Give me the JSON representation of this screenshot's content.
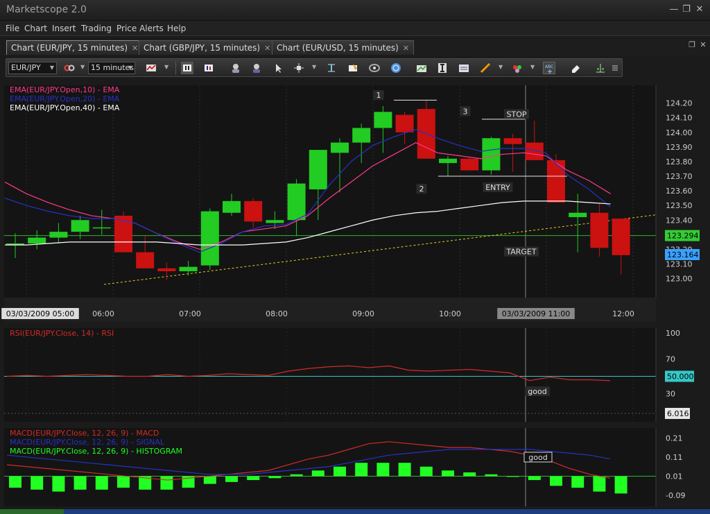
{
  "app": {
    "title": "Marketscope 2.0",
    "window_controls": [
      "minimize-icon",
      "restore-icon",
      "close-icon"
    ]
  },
  "menu": [
    "File",
    "Chart",
    "Insert",
    "Trading",
    "Price Alerts",
    "Help"
  ],
  "tabs": [
    {
      "label": "Chart (EUR/JPY, 15 minutes)",
      "active": true
    },
    {
      "label": "Chart (GBP/JPY, 15 minutes)",
      "active": false
    },
    {
      "label": "Chart (EUR/USD, 15 minutes)",
      "active": false
    }
  ],
  "toolbar": {
    "instrument": "EUR/JPY",
    "timeframe": "15 minutes",
    "icons": [
      "link-icon",
      "chart-type-icon",
      "bar-chart-icon",
      "candle-chart-icon",
      "zoom-in-icon",
      "zoom-out-icon",
      "cursor-icon",
      "crosshair-icon",
      "fibonacci-icon",
      "marker-icon",
      "target-icon",
      "globe-icon",
      "trend-line-icon",
      "text-icon",
      "chart-settings-icon",
      "pen-icon",
      "palette-icon",
      "label-icon",
      "eraser-icon",
      "layout-icon",
      "more-icon"
    ]
  },
  "main_chart": {
    "legend": [
      {
        "text": "EMA(EUR/JPY.Open,10) - EMA",
        "color": "#ff3a8a"
      },
      {
        "text": "EMA(EUR/JPY.Open,20) - EMA",
        "color": "#2632c8"
      },
      {
        "text": "EMA(EUR/JPY.Open,40) - EMA",
        "color": "#ffffff"
      }
    ],
    "y_ticks": [
      "124.20",
      "124.10",
      "124.00",
      "123.90",
      "123.80",
      "123.70",
      "123.60",
      "123.50",
      "123.40",
      "123.30",
      "123.20",
      "123.10",
      "123.00"
    ],
    "y_range": [
      122.96,
      124.26
    ],
    "price_labels": [
      {
        "text": "123.294",
        "value": 123.294,
        "bg": "#33cc33",
        "fg": "#000000"
      },
      {
        "text": "123.164",
        "value": 123.164,
        "bg": "#3aa0ff",
        "fg": "#000000"
      }
    ],
    "x_labels": [
      "03/03/2009 05:00",
      "06:00",
      "07:00",
      "08:00",
      "09:00",
      "10:00",
      "03/03/2009 11:00",
      "12:00"
    ],
    "annotations": [
      "1",
      "2",
      "3",
      "STOP",
      "ENTRY",
      "TARGET"
    ],
    "bull_color": "#22cc22",
    "bear_color": "#cc1111"
  },
  "chart_data": [
    {
      "type": "candlestick",
      "title": "EUR/JPY",
      "ylim": [
        122.96,
        124.26
      ],
      "x": [
        "04:45",
        "05:00",
        "05:15",
        "05:30",
        "05:45",
        "06:00",
        "06:15",
        "06:30",
        "06:45",
        "07:00",
        "07:15",
        "07:30",
        "07:45",
        "08:00",
        "08:15",
        "08:30",
        "08:45",
        "09:00",
        "09:15",
        "09:30",
        "09:45",
        "10:00",
        "10:15",
        "10:30",
        "10:45",
        "11:00",
        "11:15",
        "11:30",
        "11:45"
      ],
      "open": [
        123.24,
        123.24,
        123.28,
        123.32,
        123.35,
        123.43,
        123.18,
        123.07,
        123.05,
        123.09,
        123.45,
        123.53,
        123.38,
        123.4,
        123.61,
        123.86,
        123.93,
        124.03,
        124.12,
        124.16,
        123.79,
        123.82,
        123.74,
        123.96,
        123.93,
        123.81,
        123.42,
        123.45,
        123.41
      ],
      "high": [
        123.31,
        123.33,
        123.38,
        123.43,
        123.47,
        123.46,
        123.29,
        123.11,
        123.12,
        123.48,
        123.58,
        123.55,
        123.46,
        123.68,
        123.74,
        123.96,
        124.06,
        124.18,
        124.14,
        124.22,
        123.84,
        123.83,
        123.97,
        123.99,
        124.08,
        123.85,
        123.58,
        123.52,
        123.24
      ],
      "low": [
        123.14,
        123.2,
        123.24,
        123.27,
        123.3,
        123.36,
        123.07,
        122.99,
        123.02,
        123.06,
        123.43,
        123.35,
        123.34,
        123.29,
        123.4,
        123.59,
        123.79,
        123.86,
        123.92,
        123.82,
        123.7,
        123.74,
        123.71,
        123.73,
        123.86,
        123.74,
        123.18,
        123.15,
        123.03
      ],
      "close": [
        123.24,
        123.28,
        123.32,
        123.4,
        123.35,
        123.18,
        123.07,
        123.05,
        123.08,
        123.46,
        123.53,
        123.39,
        123.4,
        123.65,
        123.88,
        123.93,
        124.03,
        124.14,
        124.0,
        123.82,
        123.82,
        123.74,
        123.96,
        123.92,
        123.81,
        123.52,
        123.45,
        123.21,
        123.16
      ],
      "series": [
        {
          "name": "EMA(EUR/JPY.Open,10) - EMA",
          "color": "#ff3a8a",
          "values": [
            123.66,
            123.58,
            123.52,
            123.47,
            123.43,
            123.41,
            123.38,
            123.31,
            123.25,
            123.2,
            123.25,
            123.32,
            123.34,
            123.36,
            123.43,
            123.55,
            123.66,
            123.77,
            123.85,
            123.93,
            123.86,
            123.84,
            123.82,
            123.85,
            123.86,
            123.84,
            123.74,
            123.67,
            123.58
          ]
        },
        {
          "name": "EMA(EUR/JPY.Open,20) - EMA",
          "color": "#2632c8",
          "values": [
            123.55,
            123.5,
            123.46,
            123.43,
            123.41,
            123.41,
            123.38,
            123.31,
            123.24,
            123.18,
            123.24,
            123.32,
            123.36,
            123.37,
            123.44,
            123.64,
            123.8,
            123.91,
            123.97,
            124.02,
            123.96,
            123.91,
            123.87,
            123.89,
            123.89,
            123.86,
            123.71,
            123.61,
            123.49
          ]
        },
        {
          "name": "EMA(EUR/JPY.Open,40) - EMA",
          "color": "#ffffff",
          "values": [
            123.23,
            123.23,
            123.24,
            123.25,
            123.25,
            123.25,
            123.25,
            123.25,
            123.24,
            123.23,
            123.23,
            123.23,
            123.24,
            123.25,
            123.28,
            123.32,
            123.36,
            123.4,
            123.43,
            123.45,
            123.46,
            123.48,
            123.5,
            123.52,
            123.53,
            123.53,
            123.53,
            123.52,
            123.51
          ]
        }
      ]
    },
    {
      "type": "line",
      "title": "RSI(EUR/JPY.Close, 14) - RSI",
      "ylim": [
        0,
        100
      ],
      "y_ticks": [
        "100",
        "70",
        "50",
        "30"
      ],
      "reference_line": {
        "value": 50,
        "label": "50.000",
        "color": "#36c8c8"
      },
      "current_label": "6.016",
      "annotation": "good",
      "series": [
        {
          "name": "RSI(EUR/JPY.Close, 14) - RSI",
          "color": "#d42a2a",
          "values": [
            50,
            51,
            50,
            51,
            52,
            51,
            50,
            50,
            52,
            50,
            51,
            53,
            52,
            51,
            56,
            59,
            61,
            62,
            60,
            62,
            57,
            56,
            57,
            58,
            56,
            54,
            45,
            49,
            46,
            46,
            45
          ]
        }
      ]
    },
    {
      "type": "bar",
      "title": "MACD(EUR/JPY.Close, 12, 26, 9)",
      "ylim": [
        -0.14,
        0.24
      ],
      "y_ticks": [
        "0.21",
        "0.11",
        "0.01",
        "-0.09"
      ],
      "annotation": "good",
      "series": [
        {
          "name": "MACD(EUR/JPY.Close, 12, 26, 9) - MACD",
          "color": "#d42a2a",
          "kind": "line",
          "values": [
            0.07,
            0.06,
            0.05,
            0.04,
            0.03,
            0.02,
            0.01,
            0.0,
            -0.01,
            0.0,
            0.01,
            0.02,
            0.03,
            0.04,
            0.07,
            0.1,
            0.12,
            0.15,
            0.18,
            0.19,
            0.18,
            0.17,
            0.16,
            0.16,
            0.15,
            0.14,
            0.12,
            0.09,
            0.05,
            0.02,
            0.0
          ]
        },
        {
          "name": "MACD(EUR/JPY.Close, 12, 26, 9) - SIGNAL",
          "color": "#2632c8",
          "kind": "line",
          "values": [
            0.12,
            0.11,
            0.1,
            0.09,
            0.08,
            0.07,
            0.06,
            0.05,
            0.04,
            0.03,
            0.02,
            0.02,
            0.02,
            0.03,
            0.04,
            0.05,
            0.06,
            0.08,
            0.1,
            0.12,
            0.13,
            0.14,
            0.15,
            0.15,
            0.15,
            0.15,
            0.15,
            0.14,
            0.13,
            0.12,
            0.1
          ]
        },
        {
          "name": "MACD(EUR/JPY.Close, 12, 26, 9) - HISTOGRAM",
          "color": "#22ff22",
          "kind": "bar",
          "values": [
            -0.06,
            -0.07,
            -0.08,
            -0.07,
            -0.07,
            -0.06,
            -0.07,
            -0.07,
            -0.06,
            -0.04,
            -0.03,
            -0.02,
            -0.01,
            0.01,
            0.03,
            0.05,
            0.07,
            0.07,
            0.07,
            0.05,
            0.03,
            0.02,
            0.01,
            0.0,
            -0.02,
            -0.05,
            -0.06,
            -0.08,
            -0.09
          ]
        }
      ]
    }
  ]
}
